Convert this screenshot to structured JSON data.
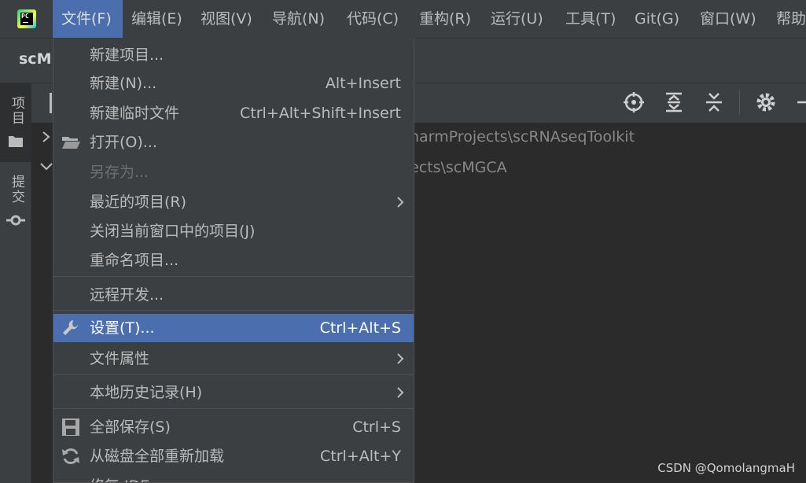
{
  "menubar": {
    "items": [
      {
        "label": "文件(F)"
      },
      {
        "label": "编辑(E)"
      },
      {
        "label": "视图(V)"
      },
      {
        "label": "导航(N)"
      },
      {
        "label": "代码(C)"
      },
      {
        "label": "重构(R)"
      },
      {
        "label": "运行(U)"
      },
      {
        "label": "工具(T)"
      },
      {
        "label": "Git(G)"
      },
      {
        "label": "窗口(W)"
      },
      {
        "label": "帮助"
      }
    ],
    "logo_text": "PC"
  },
  "project_tab": {
    "label": "scM"
  },
  "tool_stripe": {
    "project_label": "项目",
    "commit_label": "提交"
  },
  "tree": {
    "row1_path": "harmProjects\\scRNAseqToolkit",
    "row2_path": "ects\\scMGCA"
  },
  "file_menu": {
    "items": [
      {
        "label": "新建项目...",
        "shortcut": ""
      },
      {
        "label": "新建(N)...",
        "shortcut": "Alt+Insert"
      },
      {
        "label": "新建临时文件",
        "shortcut": "Ctrl+Alt+Shift+Insert"
      },
      {
        "label": "打开(O)...",
        "shortcut": "",
        "icon": "folder-icon"
      },
      {
        "label": "另存为...",
        "shortcut": "",
        "disabled": true
      },
      {
        "label": "最近的项目(R)",
        "shortcut": "",
        "submenu": true
      },
      {
        "label": "关闭当前窗口中的项目(J)",
        "shortcut": ""
      },
      {
        "label": "重命名项目...",
        "shortcut": ""
      },
      {
        "label": "远程开发...",
        "shortcut": ""
      },
      {
        "label": "设置(T)...",
        "shortcut": "Ctrl+Alt+S",
        "icon": "wrench-icon",
        "selected": true
      },
      {
        "label": "文件属性",
        "shortcut": "",
        "submenu": true
      },
      {
        "label": "本地历史记录(H)",
        "shortcut": "",
        "submenu": true
      },
      {
        "label": "全部保存(S)",
        "shortcut": "Ctrl+S",
        "icon": "save-icon"
      },
      {
        "label": "从磁盘全部重新加载",
        "shortcut": "Ctrl+Alt+Y",
        "icon": "reload-icon"
      },
      {
        "label": "修复 IDE",
        "shortcut": ""
      }
    ]
  },
  "watermark": "CSDN @QomolangmaH",
  "colors": {
    "menu_bg": "#3c3f41",
    "selection": "#4b6eaf",
    "editor_bg": "#2b2b2b"
  }
}
